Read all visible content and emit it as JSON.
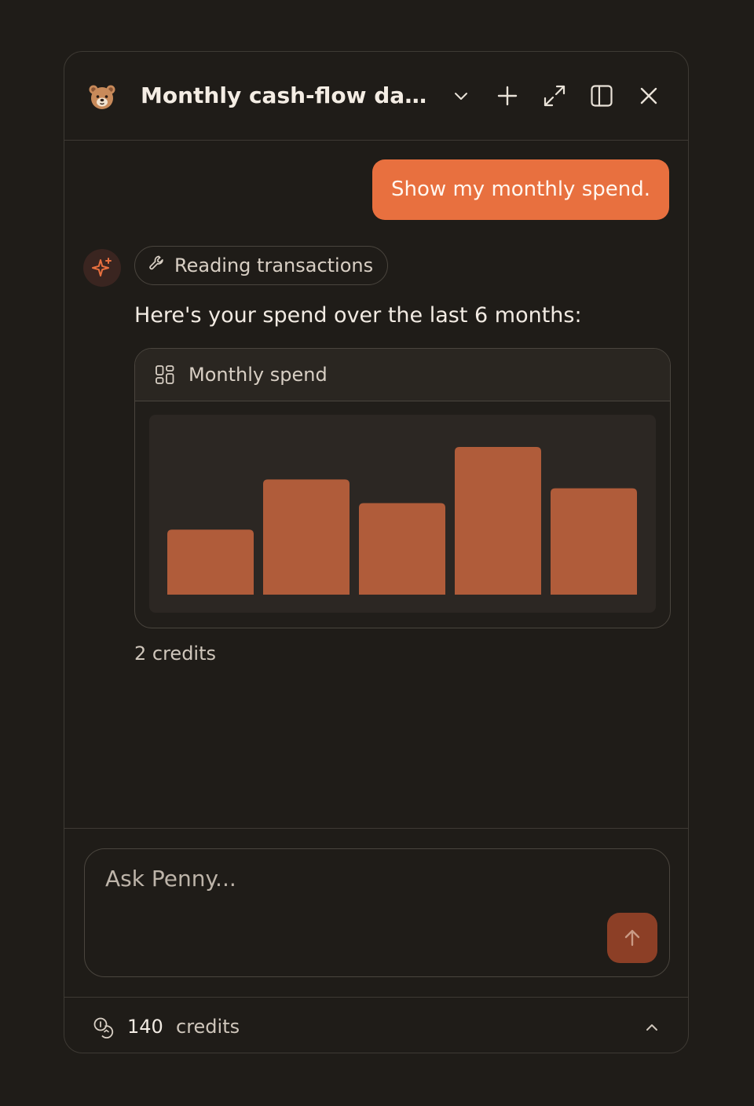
{
  "header": {
    "title": "Monthly cash-flow dashboard",
    "icons": [
      "bear-logo-icon",
      "chevron-down-icon",
      "plus-icon",
      "expand-icon",
      "sidebar-panel-icon",
      "close-icon"
    ]
  },
  "conversation": {
    "user_message": "Show my monthly spend.",
    "tool_chip_label": "Reading transactions",
    "assistant_text": "Here's your spend over the last 6 months:",
    "credits_used": "2 credits"
  },
  "widget": {
    "title": "Monthly spend"
  },
  "chart_data": {
    "type": "bar",
    "values": [
      0.44,
      0.78,
      0.62,
      1.0,
      0.72
    ],
    "color": "#b05c3a",
    "grid": false,
    "axes_visible": false
  },
  "composer": {
    "placeholder": "Ask Penny..."
  },
  "footer": {
    "credits_count": "140",
    "credits_label": "credits"
  },
  "colors": {
    "background": "#1f1c18",
    "accent": "#e8703f",
    "send_button": "#8c3f26",
    "bar": "#b05c3a"
  }
}
